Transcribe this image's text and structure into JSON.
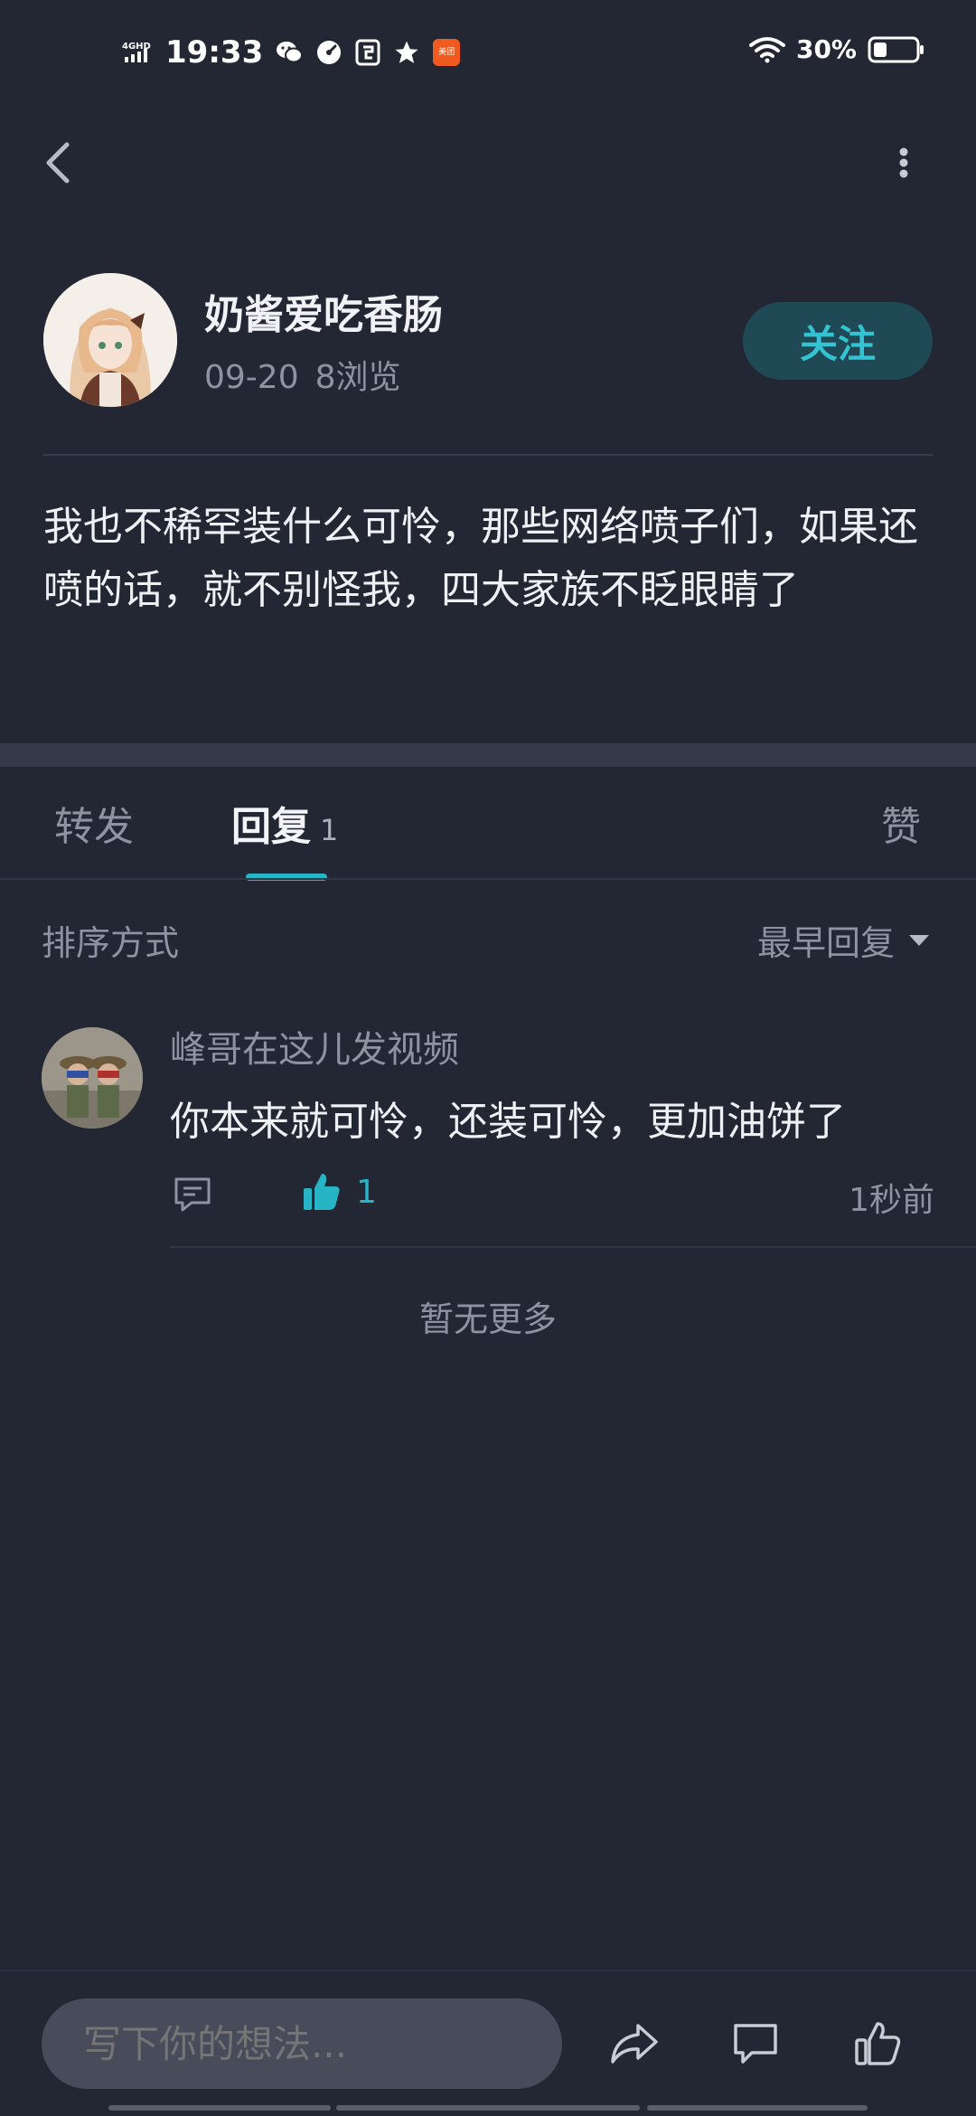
{
  "status_bar": {
    "network": "4GHD",
    "time": "19:33",
    "battery": "30%",
    "app_badge": "美团"
  },
  "author": {
    "name": "奶酱爱吃香肠",
    "date": "09-20",
    "views": "8浏览",
    "follow_label": "关注"
  },
  "post": {
    "content": "我也不稀罕装什么可怜，那些网络喷子们，如果还喷的话，就不别怪我，四大家族不眨眼睛了"
  },
  "tabs": {
    "forward": "转发",
    "reply": "回复",
    "reply_count": "1",
    "like": "赞"
  },
  "sort": {
    "label": "排序方式",
    "selected": "最早回复"
  },
  "comments": [
    {
      "user": "峰哥在这儿发视频",
      "text": "你本来就可怜，还装可怜，更加油饼了",
      "likes": "1",
      "time": "1秒前"
    }
  ],
  "footer_note": "暂无更多",
  "input": {
    "placeholder": "写下你的想法..."
  },
  "colors": {
    "background": "#232633",
    "accent": "#27b5c6",
    "follow_bg": "#1f4a55",
    "muted_text": "#8e93a2"
  },
  "icons": [
    "back-icon",
    "more-vertical-icon",
    "reply-icon",
    "thumbs-up-icon",
    "share-icon",
    "comment-icon",
    "like-outline-icon",
    "caret-down-icon"
  ]
}
